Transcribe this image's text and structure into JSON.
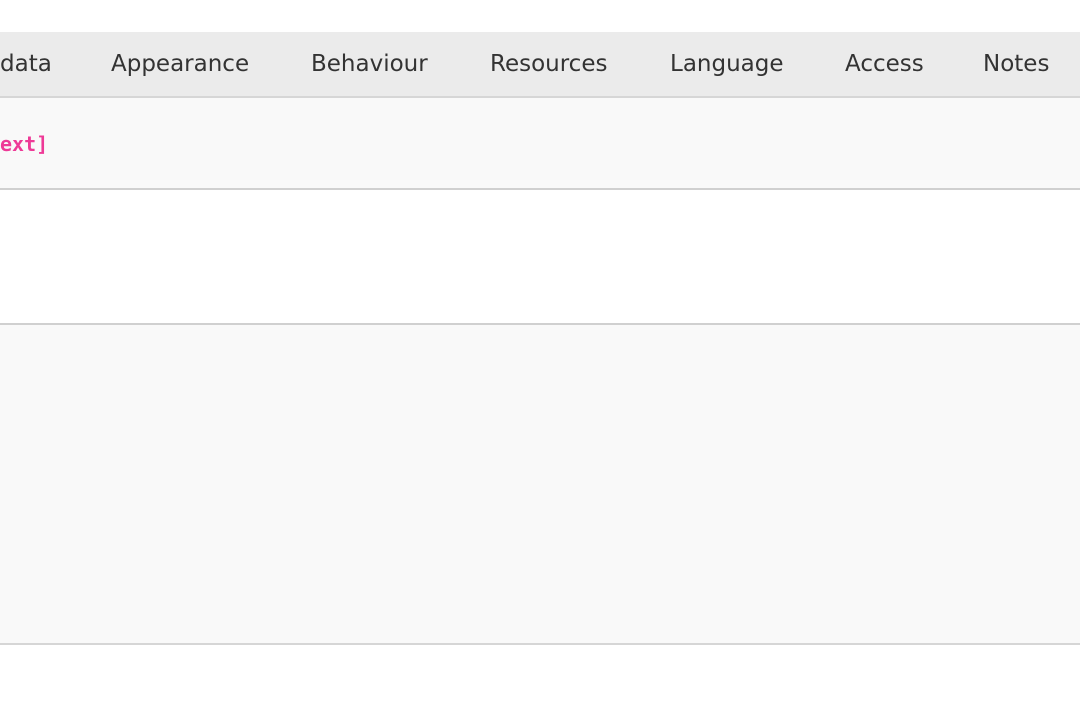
{
  "tabs": [
    {
      "label": "data"
    },
    {
      "label": "Appearance"
    },
    {
      "label": "Behaviour"
    },
    {
      "label": "Resources"
    },
    {
      "label": "Language"
    },
    {
      "label": "Access"
    },
    {
      "label": "Notes"
    }
  ],
  "content": {
    "code_text": "ext]"
  },
  "colors": {
    "tab_bar": "#ebebeb",
    "code_accent": "#ee3a97",
    "row_alt": "#f9f9f9"
  }
}
